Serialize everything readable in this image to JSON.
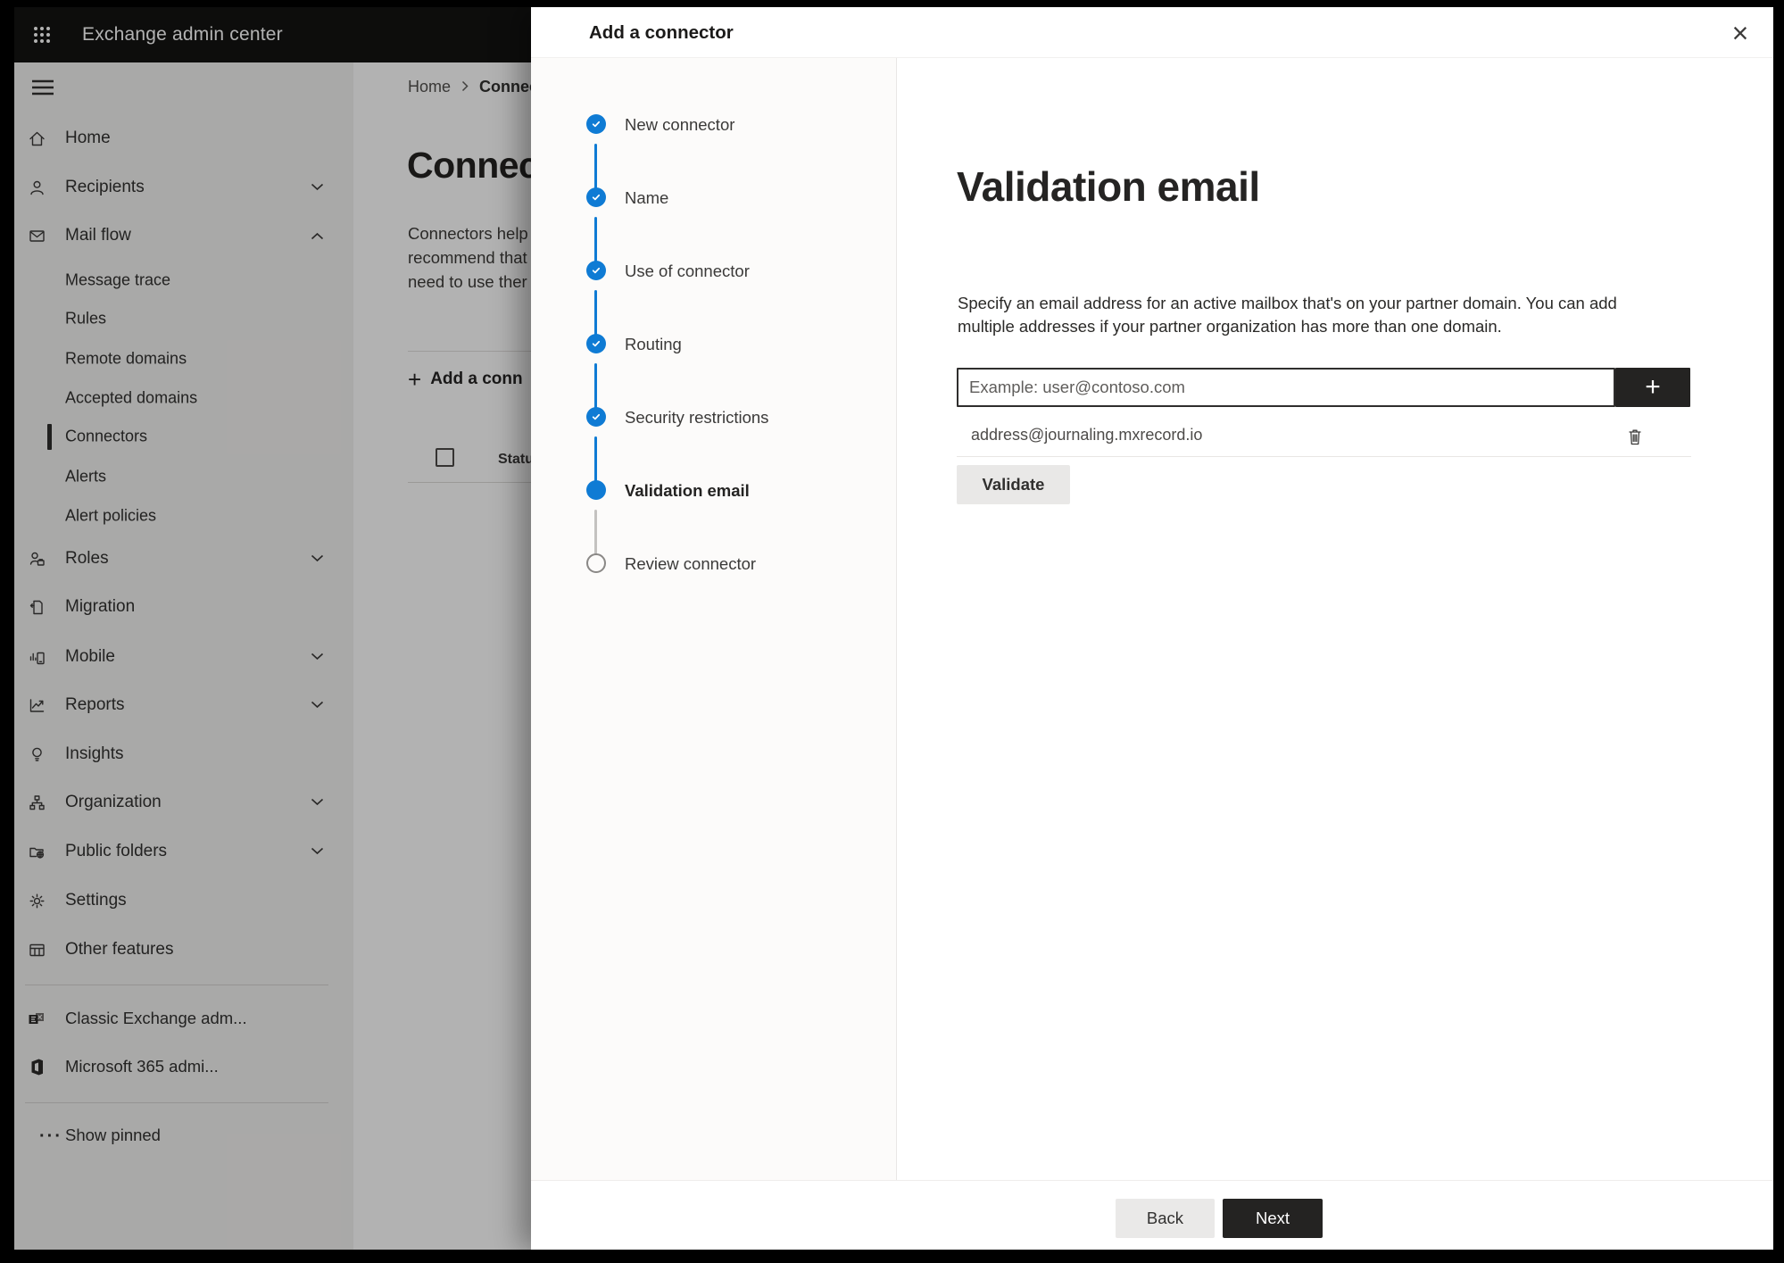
{
  "header": {
    "app_title": "Exchange admin center"
  },
  "breadcrumb": {
    "items": [
      "Home",
      "Connec"
    ],
    "separator": "›"
  },
  "page": {
    "title": "Connect",
    "description_lines": [
      "Connectors help",
      "recommend that",
      "need to use ther"
    ],
    "add_connector_label": "Add a conn",
    "add_plus": "+",
    "status_column": "Status"
  },
  "sidebar": {
    "items": [
      {
        "label": "Home"
      },
      {
        "label": "Recipients"
      },
      {
        "label": "Mail flow"
      },
      {
        "label": "Message trace"
      },
      {
        "label": "Rules"
      },
      {
        "label": "Remote domains"
      },
      {
        "label": "Accepted domains"
      },
      {
        "label": "Connectors",
        "selected": true
      },
      {
        "label": "Alerts"
      },
      {
        "label": "Alert policies"
      },
      {
        "label": "Roles"
      },
      {
        "label": "Migration"
      },
      {
        "label": "Mobile"
      },
      {
        "label": "Reports"
      },
      {
        "label": "Insights"
      },
      {
        "label": "Organization"
      },
      {
        "label": "Public folders"
      },
      {
        "label": "Settings"
      },
      {
        "label": "Other features"
      },
      {
        "label": "Classic Exchange adm..."
      },
      {
        "label": "Microsoft 365 admi..."
      },
      {
        "label": "Show pinned"
      }
    ]
  },
  "modal": {
    "title": "Add a connector",
    "steps": [
      {
        "label": "New connector",
        "state": "done"
      },
      {
        "label": "Name",
        "state": "done"
      },
      {
        "label": "Use of connector",
        "state": "done"
      },
      {
        "label": "Routing",
        "state": "done"
      },
      {
        "label": "Security restrictions",
        "state": "done"
      },
      {
        "label": "Validation email",
        "state": "current"
      },
      {
        "label": "Review connector",
        "state": "todo"
      }
    ],
    "heading": "Validation email",
    "description_lines": [
      "Specify an email address for an active mailbox that's on your partner domain. You can add",
      "multiple addresses if your partner organization has more than one domain."
    ],
    "email_input": {
      "placeholder": "Example: user@contoso.com",
      "value": ""
    },
    "added_addresses": [
      "address@journaling.mxrecord.io"
    ],
    "validate_button": "Validate",
    "back_button": "Back",
    "next_button": "Next"
  },
  "icons_text": {
    "close": "×",
    "plus": "+",
    "show_pinned_dots": "···"
  },
  "colors": {
    "accent_blue": "#0f7bd4",
    "dark_button": "#242322",
    "header_bg": "#141312",
    "sidebar_bg": "#f3f2f1"
  }
}
